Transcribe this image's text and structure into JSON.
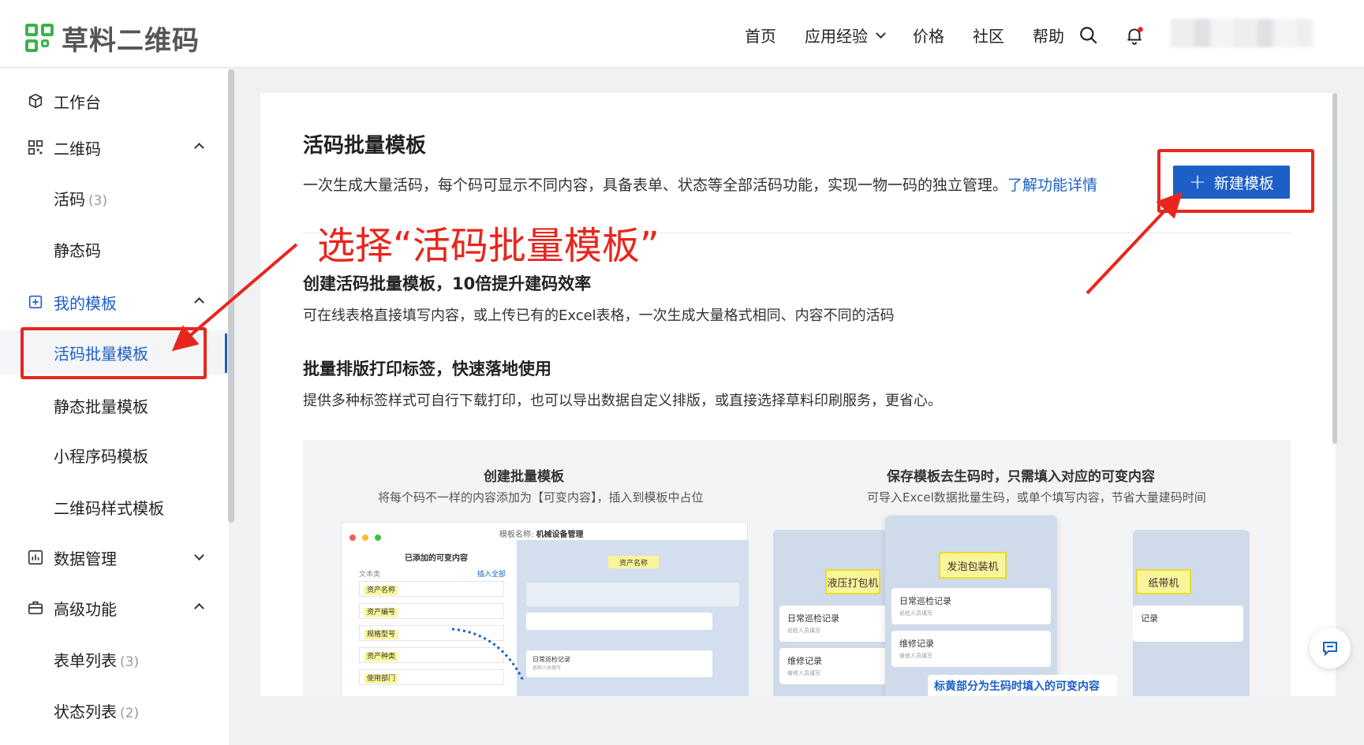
{
  "header": {
    "logo_text": "草料二维码",
    "nav": [
      "首页",
      "应用经验",
      "价格",
      "社区",
      "帮助"
    ]
  },
  "sidebar": {
    "items": [
      {
        "label": "工作台"
      },
      {
        "label": "二维码"
      },
      {
        "label": "活码",
        "count": "(3)"
      },
      {
        "label": "静态码"
      },
      {
        "label": "我的模板"
      },
      {
        "label": "活码批量模板"
      },
      {
        "label": "静态批量模板"
      },
      {
        "label": "小程序码模板"
      },
      {
        "label": "二维码样式模板"
      },
      {
        "label": "数据管理"
      },
      {
        "label": "高级功能"
      },
      {
        "label": "表单列表",
        "count": "(3)"
      },
      {
        "label": "状态列表",
        "count": "(2)"
      }
    ]
  },
  "main": {
    "title": "活码批量模板",
    "description": "一次生成大量活码，每个码可显示不同内容，具备表单、状态等全部活码功能，实现一物一码的独立管理。",
    "learn_more": "了解功能详情",
    "new_button": "新建模板",
    "section1_title": "创建活码批量模板，10倍提升建码效率",
    "section1_text": "可在线表格直接填写内容，或上传已有的Excel表格，一次生成大量格式相同、内容不同的活码",
    "section2_title": "批量排版打印标签，快速落地使用",
    "section2_text": "提供多种标签样式可自行下载打印，也可以导出数据自定义排版，或直接选择草料印刷服务，更省心。"
  },
  "preview": {
    "left_title": "创建批量模板",
    "left_sub": "将每个码不一样的内容添加为【可变内容】，插入到模板中占位",
    "right_title": "保存模板去生码时，只需填入对应的可变内容",
    "right_sub": "可导入Excel数据批量生码，或单个填写内容，节省大量建码时间",
    "mock_title_label": "模板名称:",
    "mock_title_value": "机械设备管理",
    "mock_list_title": "已添加的可变内容",
    "mock_text_type": "文本类",
    "mock_insert_all": "插入全部",
    "mock_fields": [
      "资产名称",
      "资产编号",
      "规格型号",
      "资产种类",
      "使用部门"
    ],
    "mock_header_tag": "资产名称",
    "mock_record_title": "日常巡检记录",
    "mock_record_sub": "巡检人员填写",
    "phones": [
      {
        "tag": "液压打包机",
        "rows": [
          {
            "t": "日常巡检记录",
            "s": "巡检人员填写"
          },
          {
            "t": "维修记录",
            "s": "维修人员填写"
          }
        ]
      },
      {
        "tag": "发泡包装机",
        "rows": [
          {
            "t": "日常巡检记录",
            "s": "巡检人员填写"
          },
          {
            "t": "维修记录",
            "s": "维修人员填写"
          }
        ]
      },
      {
        "tag": "纸带机",
        "rows": [
          {
            "t": "记录",
            "s": ""
          }
        ]
      }
    ],
    "bottom_caption": "标黄部分为生码时填入的可变内容"
  },
  "annotation": {
    "text": "选择“活码批量模板”"
  }
}
